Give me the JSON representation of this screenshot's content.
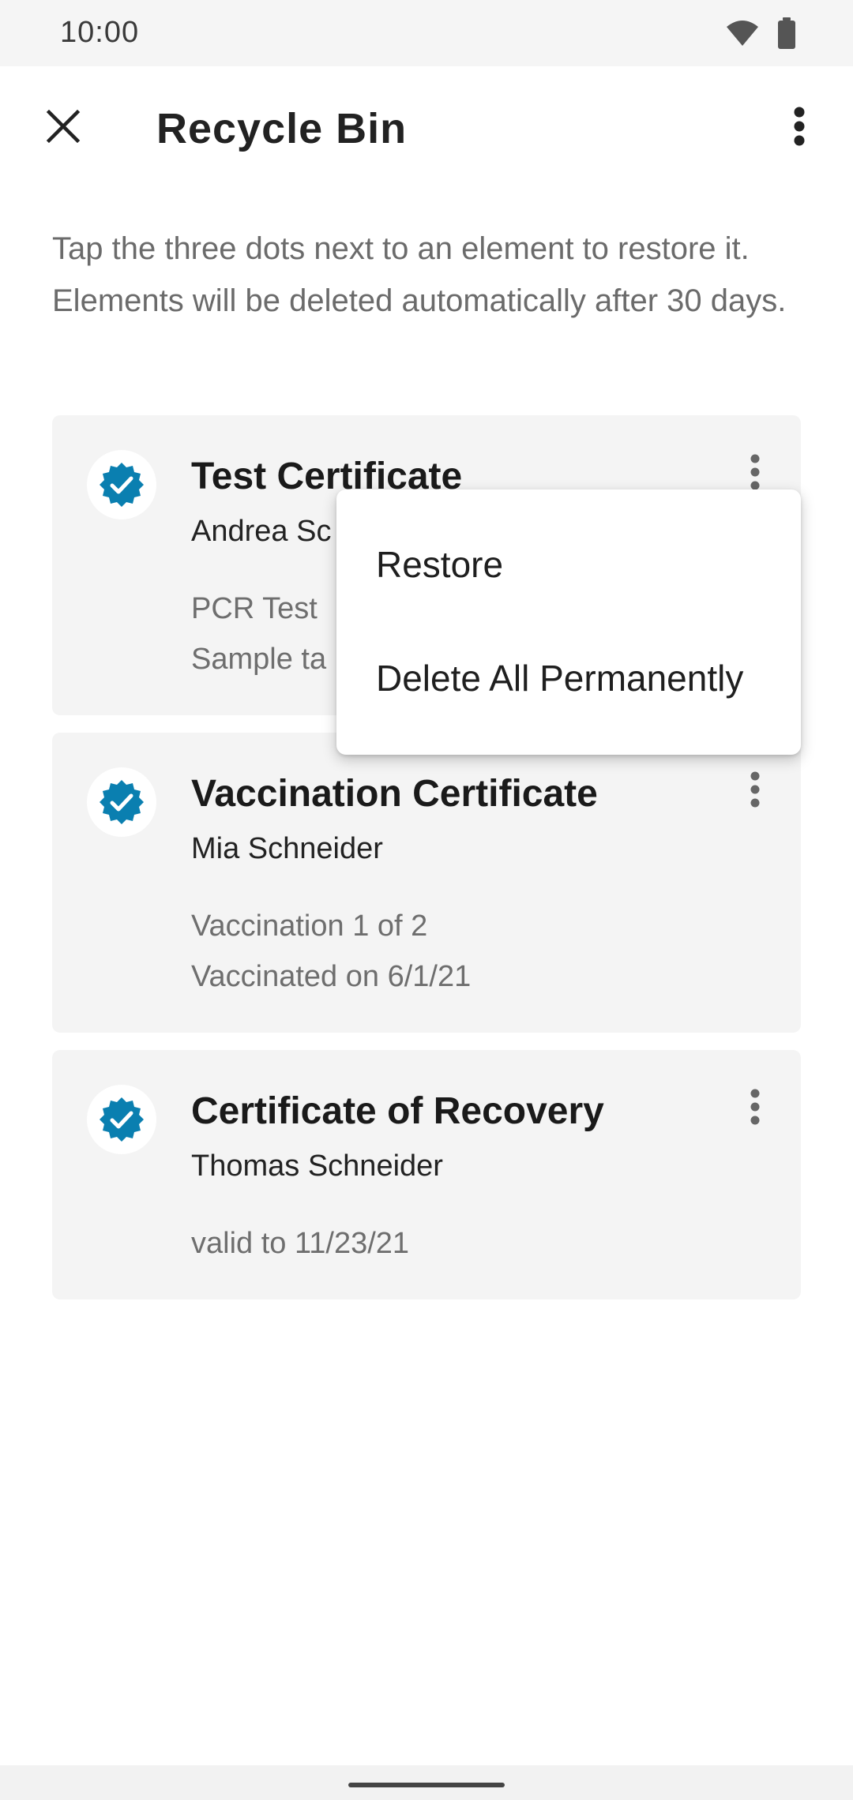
{
  "status_bar": {
    "time": "10:00",
    "icons": [
      "wifi-icon",
      "battery-icon"
    ]
  },
  "app_bar": {
    "title": "Recycle Bin",
    "close_icon": "close-icon",
    "overflow_icon": "more-vert-icon"
  },
  "description": "Tap the three dots next to an element to restore it. Elements will be deleted automatically after 30 days.",
  "colors": {
    "badge": "#0a7fb0",
    "card_background": "#f4f4f4"
  },
  "cards": [
    {
      "title": "Test Certificate",
      "name": "Andrea Sc",
      "lines": [
        "PCR Test",
        "Sample ta"
      ]
    },
    {
      "title": "Vaccination Certificate",
      "name": "Mia Schneider",
      "lines": [
        "Vaccination 1 of 2",
        "Vaccinated on 6/1/21"
      ]
    },
    {
      "title": "Certificate of Recovery",
      "name": "Thomas Schneider",
      "lines": [
        "valid to 11/23/21"
      ]
    }
  ],
  "popup_menu": {
    "items": [
      "Restore",
      "Delete All Permanently"
    ]
  }
}
